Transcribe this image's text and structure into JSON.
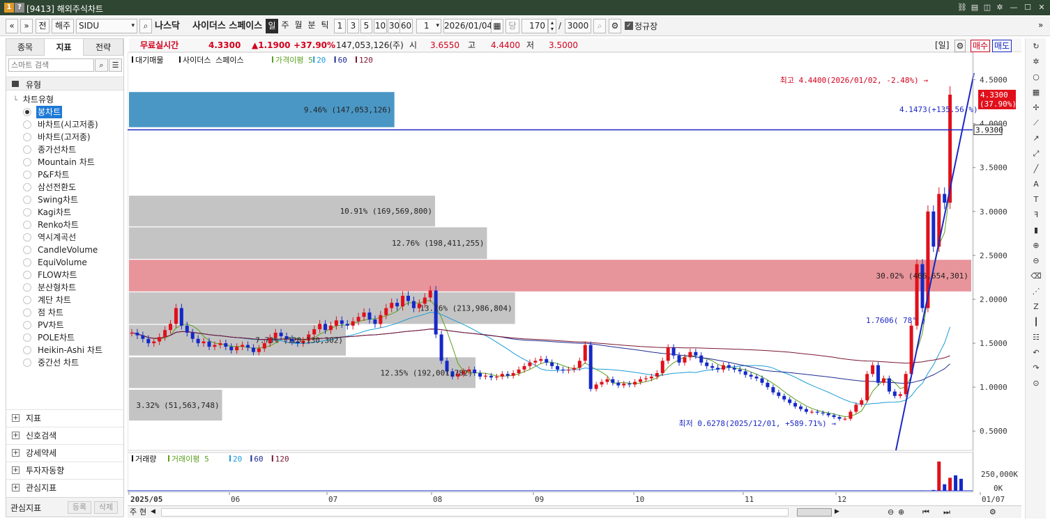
{
  "window": {
    "title": "[9413] 해외주식차트",
    "icon_a": "1",
    "icon_b": "?"
  },
  "toolbar": {
    "nav_prev": "«",
    "nav_down": "»",
    "btn_jeon": "전",
    "market": "해주",
    "symbol": "SIDU",
    "exchange": "나스닥",
    "stock_name": "사이더스 스페이스",
    "periods": [
      "일",
      "주",
      "월",
      "분",
      "틱"
    ],
    "active_period": "일",
    "intervals": [
      "1",
      "3",
      "5",
      "10",
      "30",
      "60"
    ],
    "count_select": "1",
    "date": "2026/01/04",
    "date_label": "당",
    "bars": "170",
    "max_bars": "3000",
    "regular_session_label": "정규장"
  },
  "left_panel": {
    "tabs": [
      "종목",
      "지표",
      "전략"
    ],
    "active_tab": "지표",
    "search_placeholder": "스마트 검색",
    "section_type": "유형",
    "tree_root": "차트유형",
    "chart_types": [
      "봉차트",
      "바차트(시고저종)",
      "바차트(고저종)",
      "종가선차트",
      "Mountain 차트",
      "P&F차트",
      "삼선전환도",
      "Swing차트",
      "Kagi차트",
      "Renko차트",
      "역시계곡선",
      "CandleVolume",
      "EquiVolume",
      "FLOW차트",
      "분산형차트",
      "계단 차트",
      "점 차트",
      "PV차트",
      "POLE차트",
      "Heikin-Ashi 차트",
      "중간선 차트"
    ],
    "selected_type": "봉차트",
    "sections": [
      "지표",
      "신호검색",
      "강세약세",
      "투자자동향",
      "관심지표"
    ],
    "fav_label": "관심지표",
    "fav_register": "등록",
    "fav_delete": "삭제"
  },
  "quote": {
    "realtime_label": "무료실시간",
    "price": "4.3300",
    "change": "▲1.1900",
    "change_pct": "+37.90%",
    "volume": "147,053,126(주)",
    "open_label": "시",
    "open": "3.6550",
    "high_label": "고",
    "high": "4.4400",
    "low_label": "저",
    "low": "3.5000",
    "period_badge": "[일]",
    "buy": "매수",
    "sell": "매도"
  },
  "chart_data": {
    "type": "candlestick",
    "symbol": "SIDU",
    "price_legend": [
      "대기매물",
      "사이더스 스페이스",
      "가격이평 5",
      "20",
      "60",
      "120"
    ],
    "volume_legend": [
      "거래량",
      "거래이평 5",
      "20",
      "60",
      "120"
    ],
    "y_ticks": [
      "4.5000",
      "4.0000",
      "3.5000",
      "3.0000",
      "2.5000",
      "2.0000",
      "1.5000",
      "1.0000",
      "0.5000"
    ],
    "ylim": [
      0.28,
      4.75
    ],
    "volume_ticks": [
      "250,000K",
      "0K"
    ],
    "x_ticks": [
      "2025/05",
      "06",
      "07",
      "08",
      "09",
      "10",
      "11",
      "12",
      "01/07"
    ],
    "current_price_label": "4.3300",
    "current_pct_label": "(37.90%)",
    "horizontal_line": 3.93,
    "horizontal_line_label": "3.9300",
    "high_annotation": "최고 4.4400(2026/01/02, -2.48%)",
    "low_annotation": "최저 0.6278(2025/12/01, +589.71%)",
    "trend_annotations": [
      "4.1473(+135.56 %)",
      "1.7606( 78° )"
    ],
    "volume_profile": [
      {
        "label": "9.46% (147,053,126)",
        "low": 3.96,
        "high": 4.36,
        "share": 9.46
      },
      {
        "label": "10.91% (169,569,800)",
        "low": 2.83,
        "high": 3.18,
        "share": 10.91
      },
      {
        "label": "12.76% (198,411,255)",
        "low": 2.46,
        "high": 2.82,
        "share": 12.76
      },
      {
        "label": "30.02% (466,654,301)",
        "low": 2.09,
        "high": 2.45,
        "share": 30.02
      },
      {
        "label": "13.76% (213,986,804)",
        "low": 1.72,
        "high": 2.08,
        "share": 13.76
      },
      {
        "label": "7.73% (120,130,302)",
        "low": 1.36,
        "high": 1.71,
        "share": 7.73
      },
      {
        "label": "12.35% (192,001,782)",
        "low": 0.99,
        "high": 1.34,
        "share": 12.35
      },
      {
        "label": "3.32% (51,563,748)",
        "low": 0.62,
        "high": 0.97,
        "share": 3.32
      }
    ],
    "profile_highlight": 3,
    "profile_max_highlight": 0,
    "closes": [
      1.62,
      1.59,
      1.55,
      1.5,
      1.52,
      1.57,
      1.65,
      1.72,
      1.9,
      1.7,
      1.62,
      1.55,
      1.5,
      1.52,
      1.46,
      1.48,
      1.5,
      1.46,
      1.42,
      1.46,
      1.48,
      1.45,
      1.4,
      1.44,
      1.5,
      1.56,
      1.62,
      1.58,
      1.55,
      1.52,
      1.5,
      1.53,
      1.6,
      1.66,
      1.72,
      1.65,
      1.7,
      1.76,
      1.72,
      1.7,
      1.75,
      1.8,
      1.85,
      1.77,
      1.72,
      1.82,
      1.9,
      1.96,
      1.92,
      2.04,
      1.98,
      1.9,
      1.95,
      2.02,
      2.1,
      1.6,
      1.3,
      1.18,
      1.12,
      1.15,
      1.18,
      1.2,
      1.16,
      1.12,
      1.13,
      1.11,
      1.12,
      1.15,
      1.13,
      1.16,
      1.2,
      1.24,
      1.28,
      1.3,
      1.32,
      1.28,
      1.24,
      1.2,
      1.19,
      1.2,
      1.22,
      1.3,
      1.48,
      0.98,
      1.03,
      1.06,
      1.09,
      1.05,
      1.02,
      1.04,
      1.03,
      1.06,
      1.09,
      1.1,
      1.12,
      1.16,
      1.3,
      1.45,
      1.36,
      1.28,
      1.34,
      1.4,
      1.36,
      1.28,
      1.24,
      1.22,
      1.2,
      1.25,
      1.22,
      1.2,
      1.18,
      1.14,
      1.12,
      1.1,
      1.05,
      1.0,
      0.94,
      0.9,
      0.86,
      0.82,
      0.78,
      0.75,
      0.72,
      0.72,
      0.71,
      0.7,
      0.68,
      0.66,
      0.64,
      0.64,
      0.72,
      0.8,
      0.85,
      1.15,
      1.25,
      1.05,
      1.1,
      0.95,
      0.9,
      0.92,
      1.15,
      1.7,
      2.4,
      1.9,
      3.0,
      2.6,
      3.2,
      3.1,
      4.33
    ],
    "volumes": [
      0,
      0,
      0,
      0,
      0,
      0,
      0,
      0,
      0,
      0,
      0,
      0,
      0,
      0,
      0,
      0,
      0,
      0,
      0,
      0,
      0,
      0,
      0,
      0,
      0,
      0,
      0,
      0,
      0,
      0,
      0,
      0,
      0,
      0,
      0,
      0,
      0,
      0,
      0,
      0,
      0,
      0,
      0,
      0,
      0,
      0,
      0,
      0,
      0,
      0,
      0,
      0,
      0,
      0,
      0,
      0,
      0,
      0,
      0,
      0,
      0,
      0,
      0,
      0,
      0,
      0,
      0,
      0,
      0,
      0,
      0,
      0,
      0,
      0,
      0,
      0,
      0,
      0,
      0,
      0,
      0,
      0,
      0,
      0,
      0,
      0,
      0,
      0,
      0,
      0,
      0,
      0,
      0,
      0,
      0,
      0,
      0,
      0,
      0,
      0,
      0,
      0,
      0,
      0,
      0,
      0,
      0,
      0,
      0,
      0,
      0,
      0,
      0,
      0,
      0,
      0,
      0,
      0,
      0,
      0,
      0,
      0,
      0,
      0,
      0,
      0,
      0,
      0,
      0,
      0,
      0,
      0,
      0,
      0,
      0,
      0,
      0,
      0,
      0,
      0,
      0,
      0,
      0,
      5,
      3,
      10,
      360,
      80,
      160,
      190,
      147
    ],
    "colors": {
      "up": "#e0101b",
      "down": "#1529c8",
      "ma5": "#5aa01e",
      "ma20": "#1e9bd8",
      "ma60": "#1d2b8f",
      "ma120": "#7a1530",
      "profile": "#c4c4c4",
      "profile_max": "#4a97c5",
      "profile_hot": "#e8949b"
    }
  },
  "bottom": {
    "mode": "주",
    "mode2": "현"
  },
  "icons": {
    "right_toolbar": [
      "refresh-icon",
      "settings-icon",
      "circle-icon",
      "bar-chart-icon",
      "crosshair-icon",
      "line-icon",
      "arrow-line-icon",
      "ray-icon",
      "diagonal-icon",
      "auto-icon",
      "text-icon",
      "fibonacci-icon",
      "candle-icon",
      "zoom-in-icon",
      "zoom-out-icon",
      "erase-icon",
      "gann-icon",
      "zigzag-icon",
      "vertical-lines-icon",
      "grid-icon",
      "undo-icon",
      "redo-icon",
      "magnet-icon"
    ]
  }
}
